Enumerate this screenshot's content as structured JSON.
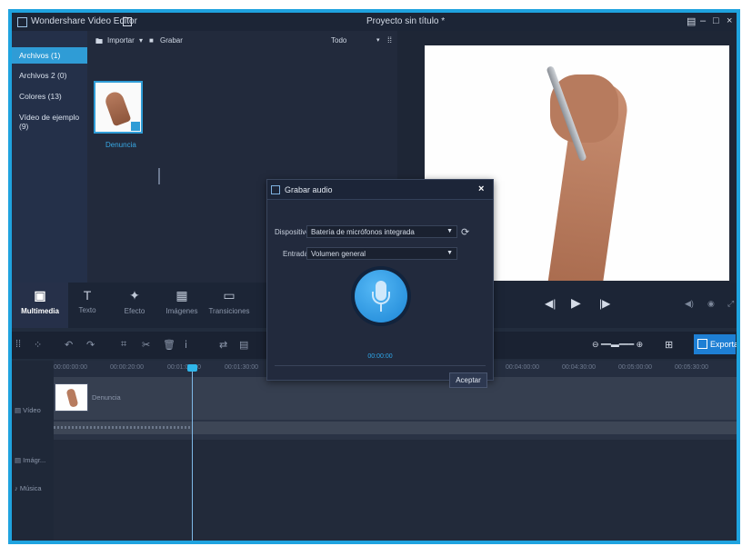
{
  "titlebar": {
    "app_title": "Wondershare Video Editor",
    "project_name": "Proyecto sin título *",
    "window_buttons": [
      "restore",
      "minimize",
      "maximize",
      "close"
    ]
  },
  "library": {
    "categories": [
      {
        "label": "Archivos (1)",
        "active": true
      },
      {
        "label": "Archivos 2 (0)",
        "active": false
      },
      {
        "label": "Colores (13)",
        "active": false
      },
      {
        "label": "Vídeo de ejemplo (9)",
        "active": false
      }
    ],
    "import_label": "Importar",
    "record_label": "Grabar",
    "filter_value": "Todo",
    "media_items": [
      {
        "name": "Denuncia"
      }
    ]
  },
  "tools": [
    {
      "label": "Multimedia",
      "icon": "media-icon",
      "active": true
    },
    {
      "label": "Texto",
      "icon": "text-icon",
      "active": false
    },
    {
      "label": "Efecto",
      "icon": "effect-icon",
      "active": false
    },
    {
      "label": "Imágenes",
      "icon": "images-icon",
      "active": false
    },
    {
      "label": "Transiciones",
      "icon": "transitions-icon",
      "active": false
    }
  ],
  "timeline": {
    "export_label": "Exportar",
    "ruler_ticks": [
      "00:00:00:00",
      "00:00:20:00",
      "00:01:00:00",
      "00:01:30:00",
      "00:04:00:00",
      "00:04:30:00",
      "00:05:00:00",
      "00:05:30:00"
    ],
    "tracks": [
      {
        "label": "Vídeo",
        "icon": "video-track-icon"
      },
      {
        "label": "Imágr...",
        "icon": "image-track-icon"
      },
      {
        "label": "Música",
        "icon": "music-track-icon"
      }
    ],
    "clip_name": "Denuncia"
  },
  "dialog": {
    "title": "Grabar audio",
    "device_label": "Dispositivo:",
    "device_value": "Batería de micrófonos integrada",
    "input_label": "Entrada:",
    "input_value": "Volumen general",
    "timer": "00:00:00",
    "accept_label": "Aceptar"
  },
  "colors": {
    "accent": "#2f9cd6",
    "export": "#1e7fd4",
    "frame": "#1fa3df"
  }
}
